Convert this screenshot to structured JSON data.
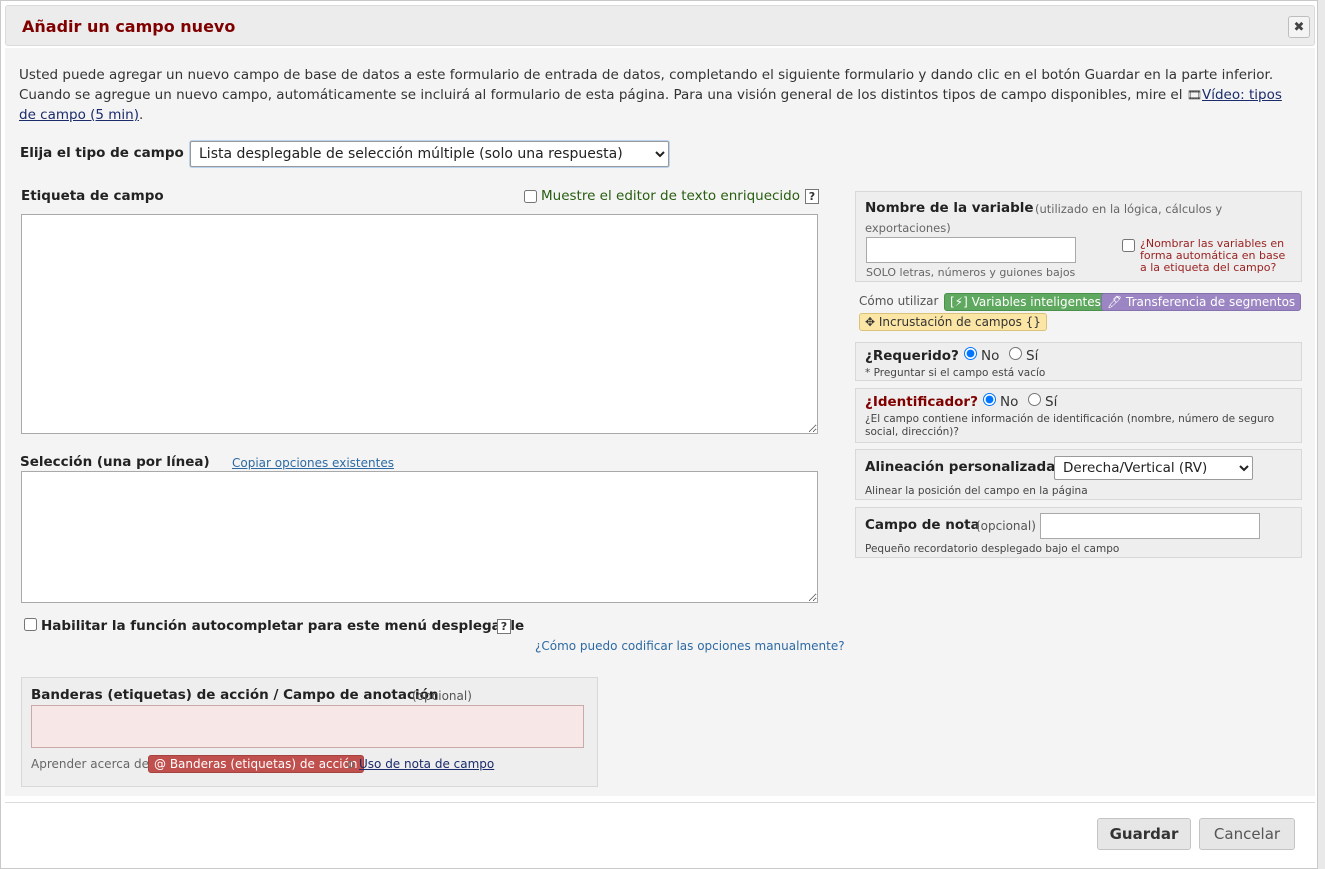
{
  "dialog": {
    "title": "Añadir un campo nuevo",
    "close_glyph": "✖"
  },
  "intro": {
    "text_before_link": "Usted puede agregar un nuevo campo de base de datos a este formulario de entrada de datos, completando el siguiente formulario y dando clic en el botón Guardar en la parte inferior. Cuando se agregue un nuevo campo, automáticamente se incluirá al formulario de esta página. Para una visión general de los distintos tipos de campo disponibles, mire el ",
    "video_link": "Vídeo: tipos de campo (5 min)",
    "after_link": "."
  },
  "field_type": {
    "label": "Elija el tipo de campo",
    "selected": "Lista desplegable de selección múltiple (solo una respuesta)"
  },
  "field_label": {
    "label": "Etiqueta de campo",
    "rich_text_label": "Muestre el editor de texto enriquecido",
    "help": "?"
  },
  "choices": {
    "label": "Selección (una por línea)",
    "copy_link": "Copiar opciones existentes"
  },
  "autocomplete": {
    "label": "Habilitar la función autocompletar para este menú desplegable",
    "help": "?",
    "manual_link": "¿Cómo puedo codificar las opciones manualmente?"
  },
  "action_tags": {
    "label_a": "Banderas (etiquetas) de acción",
    "separator": " / ",
    "label_b": "Campo de anotación",
    "optional": "(opcional)",
    "learn_prefix": "Aprender acerca de",
    "badge": "@ Banderas (etiquetas) de acción",
    "or": "o",
    "note_link": "Uso de nota de campo"
  },
  "variable": {
    "label": "Nombre de la variable",
    "hint": "(utilizado en la lógica, cálculos y exportaciones)",
    "value": "",
    "rule": "SOLO letras, números y guiones bajos",
    "auto_name": "¿Nombrar las variables en forma automática en base a la etiqueta del campo?"
  },
  "howto": {
    "label": "Cómo utilizar",
    "smart_vars": "[⚡] Variables inteligentes",
    "piping": "🖊 Transferencia de segmentos",
    "embedding": "✥ Incrustación de campos {}"
  },
  "required": {
    "label": "¿Requerido?",
    "no": "No",
    "yes": "Sí",
    "selected": "No",
    "note": "* Preguntar si el campo está vacío"
  },
  "identifier": {
    "label": "¿Identificador?",
    "no": "No",
    "yes": "Sí",
    "selected": "No",
    "note": "¿El campo contiene información de identificación (nombre, número de seguro social, dirección)?"
  },
  "alignment": {
    "label": "Alineación personalizada",
    "selected": "Derecha/Vertical (RV)",
    "note": "Alinear la posición del campo en la página"
  },
  "field_note": {
    "label": "Campo de nota",
    "optional": "(opcional)",
    "value": "",
    "note": "Pequeño recordatorio desplegado bajo el campo"
  },
  "footer": {
    "save": "Guardar",
    "cancel": "Cancelar"
  },
  "colors": {
    "title": "#800000",
    "identifier": "#800000",
    "smart_vars": "#5fa85f",
    "piping": "#9b86c3",
    "embedding": "#fbe6a6",
    "action_badge": "#c0504d"
  }
}
